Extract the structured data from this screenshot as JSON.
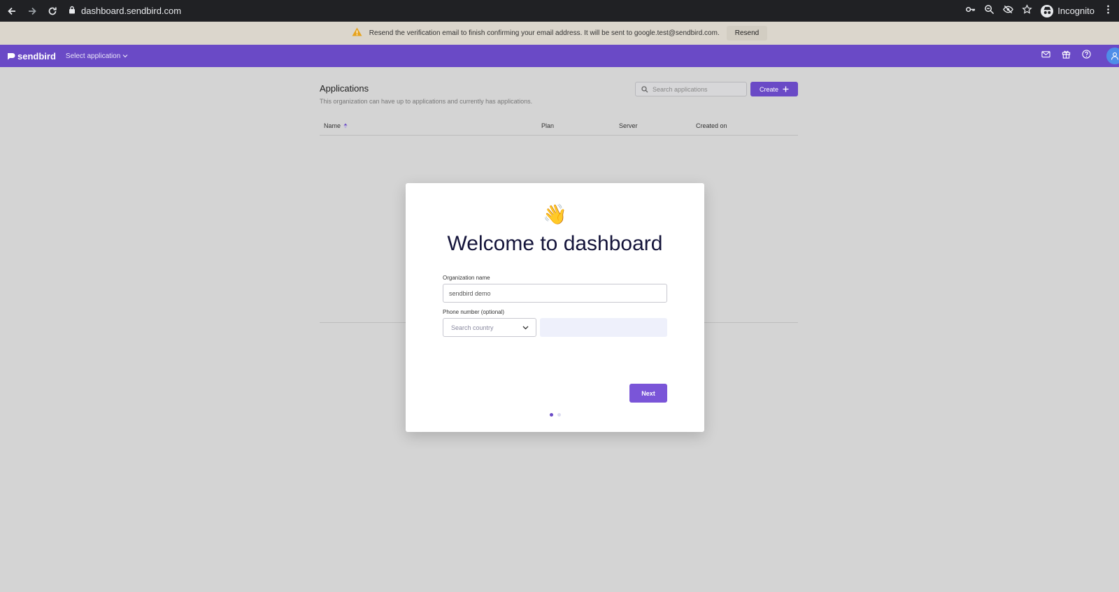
{
  "browser": {
    "url": "dashboard.sendbird.com",
    "profile_label": "Incognito"
  },
  "banner": {
    "message": "Resend the verification email to finish confirming your email address. It will be sent to google.test@sendbird.com.",
    "action_label": "Resend"
  },
  "header": {
    "logo_text": "sendbird",
    "app_selector_label": "Select application",
    "icons": [
      "mail-icon",
      "gift-icon",
      "help-icon",
      "user-icon"
    ],
    "brand_color": "#6a4ac6"
  },
  "main": {
    "title": "Applications",
    "subtitle": "This organization can have up to applications and currently has applications.",
    "search_placeholder": "Search applications",
    "create_label": "Create",
    "columns": [
      "Name",
      "Plan",
      "Server",
      "Created on"
    ]
  },
  "modal": {
    "emoji": "👋",
    "title": "Welcome to dashboard",
    "org_label": "Organization name",
    "org_value": "sendbird demo",
    "phone_label": "Phone number (optional)",
    "country_placeholder": "Search country",
    "phone_value": "",
    "next_label": "Next",
    "step": 1,
    "total_steps": 2
  }
}
